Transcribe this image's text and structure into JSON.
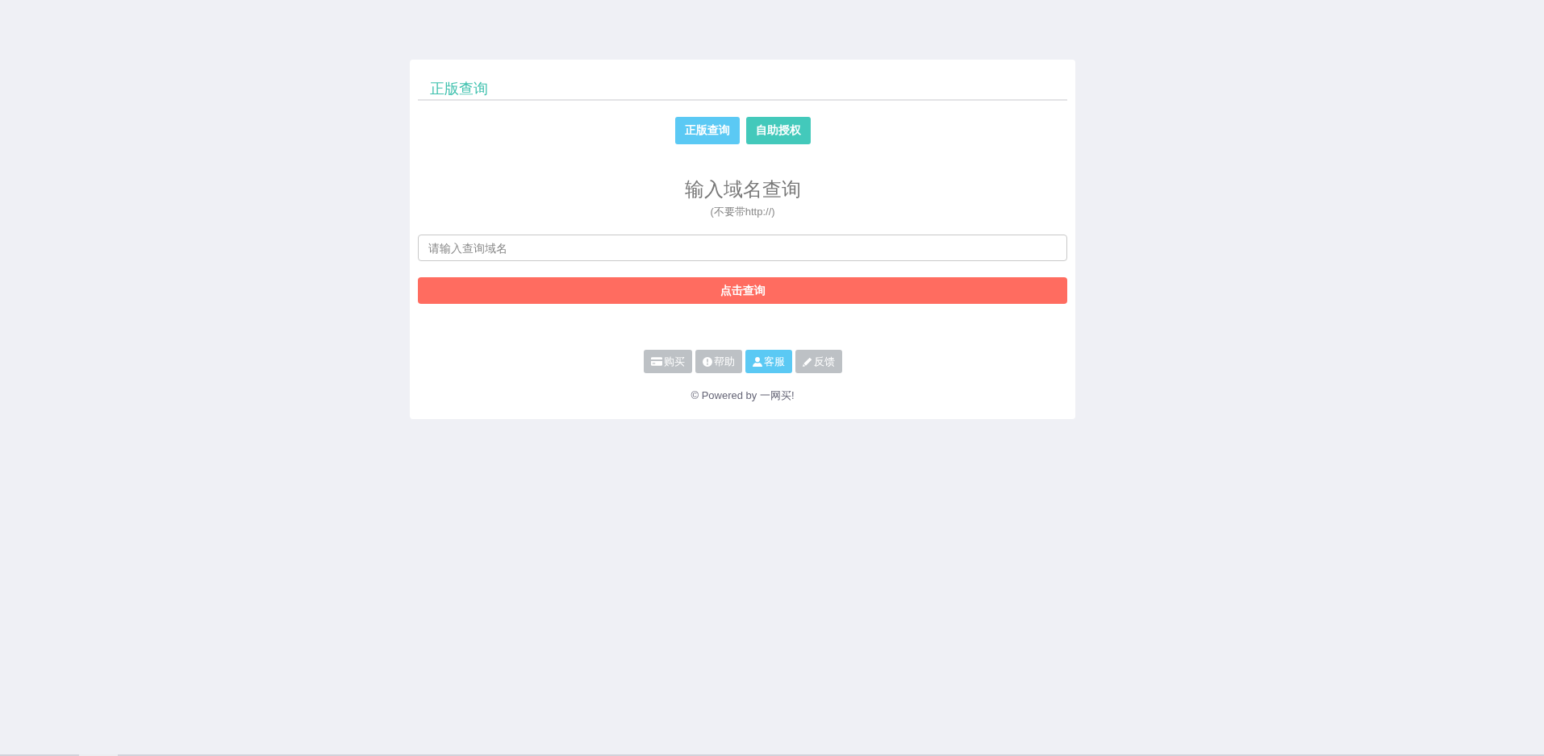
{
  "card": {
    "title": "正版查询",
    "top_buttons": [
      {
        "label": "正版查询",
        "color": "#5bc9f4"
      },
      {
        "label": "自助授权",
        "color": "#43c9bb"
      }
    ],
    "heading": "输入域名查询",
    "hint": "(不要带http://)",
    "domain_field": {
      "placeholder": "请输入查询域名"
    },
    "submit_button": {
      "label": "点击查询"
    },
    "footer_buttons": [
      {
        "label": "购买",
        "color": "#bdc1c5"
      },
      {
        "label": "帮助",
        "color": "#bdc1c5"
      },
      {
        "label": "客服",
        "color": "#5bc9f4"
      },
      {
        "label": "反馈",
        "color": "#bdc1c5"
      }
    ],
    "footer_text": "© Powered by 一网买!"
  }
}
